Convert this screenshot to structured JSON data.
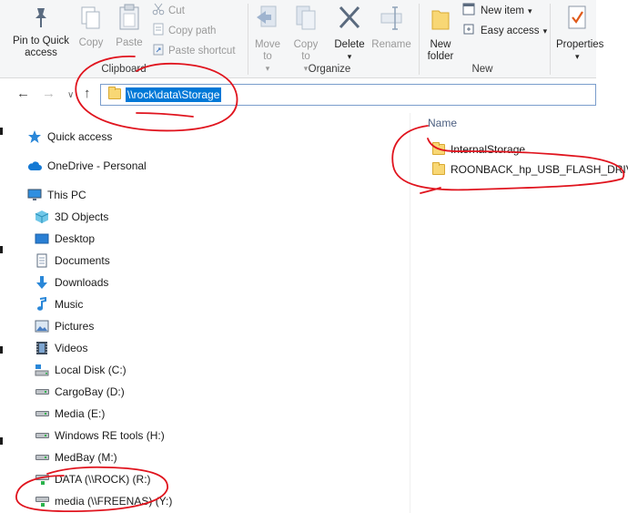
{
  "ribbon": {
    "clipboard": {
      "group_label": "Clipboard",
      "pin_label": "Pin to Quick access",
      "copy_label": "Copy",
      "paste_label": "Paste",
      "cut_label": "Cut",
      "copy_path_label": "Copy path",
      "paste_shortcut_label": "Paste shortcut"
    },
    "organize": {
      "group_label": "Organize",
      "move_to_label": "Move to",
      "copy_to_label": "Copy to",
      "delete_label": "Delete",
      "rename_label": "Rename"
    },
    "new": {
      "group_label": "New",
      "new_folder_label": "New folder",
      "new_item_label": "New item",
      "easy_access_label": "Easy access"
    },
    "open": {
      "properties_label": "Properties"
    }
  },
  "address": {
    "path": "\\\\rock\\data\\Storage"
  },
  "nav": {
    "quick_access": "Quick access",
    "onedrive": "OneDrive - Personal",
    "this_pc": "This PC",
    "items": [
      "3D Objects",
      "Desktop",
      "Documents",
      "Downloads",
      "Music",
      "Pictures",
      "Videos",
      "Local Disk (C:)",
      "CargoBay (D:)",
      "Media (E:)",
      "Windows RE tools (H:)",
      "MedBay (M:)",
      "DATA (\\\\ROCK) (R:)",
      "media (\\\\FREENAS) (Y:)"
    ]
  },
  "content": {
    "column_name": "Name",
    "files": [
      "InternalStorage",
      "ROONBACK_hp_USB_FLASH_DRIVE"
    ]
  },
  "colors": {
    "accent": "#0078d7",
    "annotation": "#e0141e"
  }
}
